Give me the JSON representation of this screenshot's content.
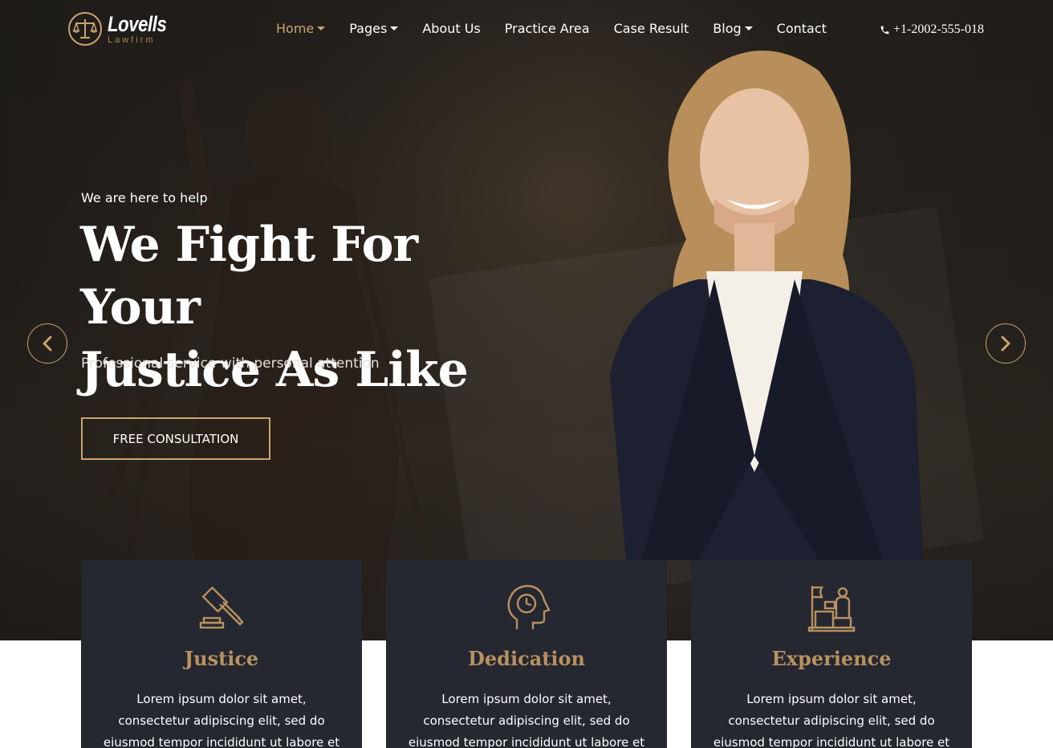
{
  "brand": {
    "name": "Lovells",
    "tagline": "Lawfirm",
    "accent": "#c9a46e"
  },
  "nav": {
    "items": [
      {
        "label": "Home",
        "dropdown": true,
        "active": true
      },
      {
        "label": "Pages",
        "dropdown": true,
        "active": false
      },
      {
        "label": "About Us",
        "dropdown": false,
        "active": false
      },
      {
        "label": "Practice Area",
        "dropdown": false,
        "active": false
      },
      {
        "label": "Case Result",
        "dropdown": false,
        "active": false
      },
      {
        "label": "Blog",
        "dropdown": true,
        "active": false
      },
      {
        "label": "Contact",
        "dropdown": false,
        "active": false
      }
    ],
    "phone": "+1-2002-555-018",
    "phone_icon": "phone-icon"
  },
  "hero": {
    "eyebrow": "We are here to help",
    "headline_line1": "We Fight For Your",
    "headline_line2": "Justice As Like",
    "subline": "Professional service with personal attention",
    "cta": "FREE CONSULTATION",
    "prev_icon": "chevron-left-icon",
    "next_icon": "chevron-right-icon"
  },
  "features": [
    {
      "icon": "gavel-icon",
      "title": "Justice",
      "text": "Lorem ipsum dolor sit amet, consectetur adipiscing elit, sed do eiusmod tempor incididunt ut labore et"
    },
    {
      "icon": "head-clock-icon",
      "title": "Dedication",
      "text": "Lorem ipsum dolor sit amet, consectetur adipiscing elit, sed do eiusmod tempor incididunt ut labore et"
    },
    {
      "icon": "podium-icon",
      "title": "Experience",
      "text": "Lorem ipsum dolor sit amet, consectetur adipiscing elit, sed do eiusmod tempor incididunt ut labore et"
    }
  ]
}
